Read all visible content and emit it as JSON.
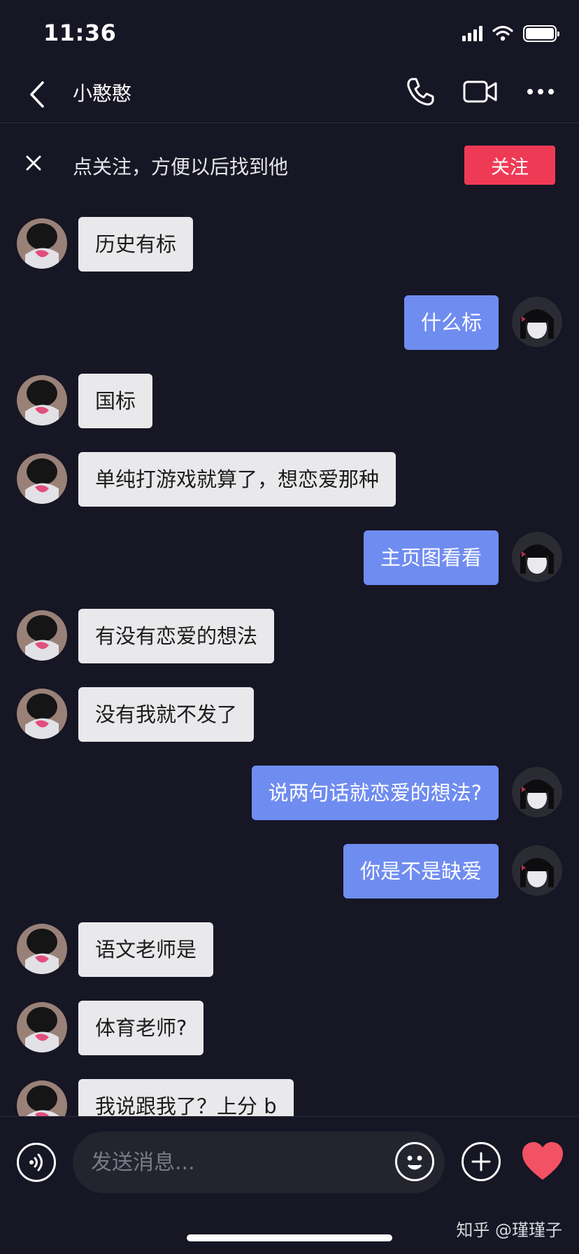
{
  "status_bar": {
    "time": "11:36"
  },
  "header": {
    "title": "小憨憨"
  },
  "banner": {
    "text": "点关注，方便以后找到他",
    "follow_label": "关注"
  },
  "colors": {
    "background": "#161624",
    "incoming_bubble": "#e9e9ec",
    "outgoing_bubble": "#6f8cf0",
    "follow_button": "#ef3a56",
    "heart": "#f25263"
  },
  "messages": [
    {
      "side": "left",
      "text": "历史有标"
    },
    {
      "side": "right",
      "text": "什么标"
    },
    {
      "side": "left",
      "text": "国标"
    },
    {
      "side": "left",
      "text": "单纯打游戏就算了，想恋爱那种"
    },
    {
      "side": "right",
      "text": "主页图看看"
    },
    {
      "side": "left",
      "text": "有没有恋爱的想法"
    },
    {
      "side": "left",
      "text": "没有我就不发了"
    },
    {
      "side": "right",
      "text": "说两句话就恋爱的想法?"
    },
    {
      "side": "right",
      "text": "你是不是缺爱"
    },
    {
      "side": "left",
      "text": "语文老师是"
    },
    {
      "side": "left",
      "text": "体育老师?"
    },
    {
      "side": "left",
      "text": "我说跟我了？上分 b"
    }
  ],
  "input": {
    "placeholder": "发送消息..."
  },
  "icons": {
    "back": "chevron-left-icon",
    "call": "phone-icon",
    "video": "video-camera-icon",
    "more": "more-dots-icon",
    "close": "close-icon",
    "voice": "voice-icon",
    "emoji": "emoji-icon",
    "plus": "plus-icon",
    "heart": "heart-icon"
  },
  "watermark": "知乎 @瑾瑾子"
}
